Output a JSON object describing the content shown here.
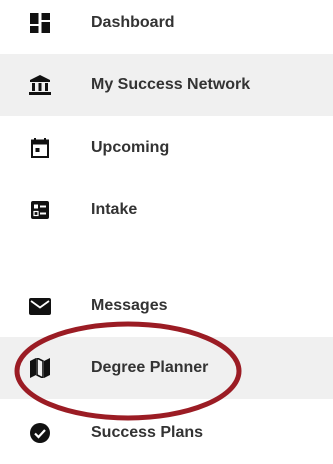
{
  "colors": {
    "icon": "#111111",
    "label": "#333333",
    "active_background": "#f0f0f0",
    "annotation_circle": "#9b1c24"
  },
  "nav": {
    "items": [
      {
        "label": "Dashboard",
        "icon": "dashboard-icon"
      },
      {
        "label": "My Success Network",
        "icon": "bank-icon",
        "active": true
      },
      {
        "label": "Upcoming",
        "icon": "calendar-icon"
      },
      {
        "label": "Intake",
        "icon": "form-icon"
      },
      {
        "label": "Messages",
        "icon": "envelope-icon"
      },
      {
        "label": "Degree Planner",
        "icon": "map-icon",
        "active": true
      },
      {
        "label": "Success Plans",
        "icon": "check-circle-icon"
      }
    ]
  }
}
